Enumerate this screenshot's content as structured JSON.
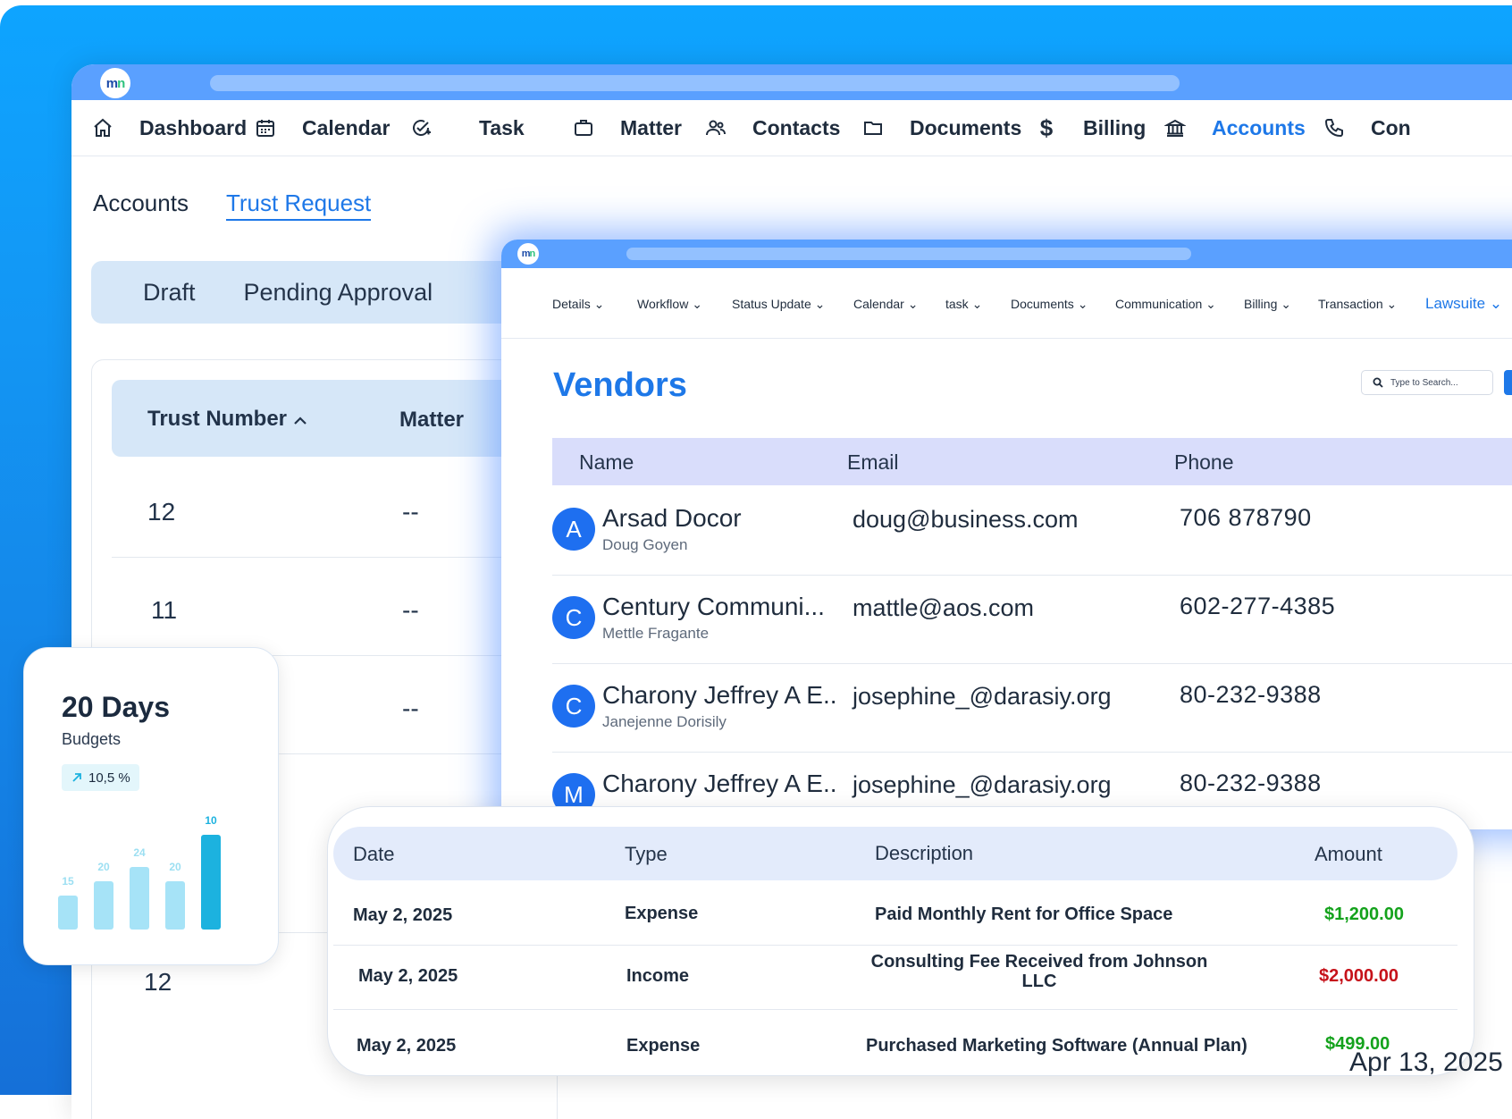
{
  "main_nav": [
    {
      "icon": "home-icon",
      "label": "Dashboard"
    },
    {
      "icon": "calendar-icon",
      "label": "Calendar"
    },
    {
      "icon": "task-check-icon",
      "label": "Task"
    },
    {
      "icon": "briefcase-icon",
      "label": "Matter"
    },
    {
      "icon": "contacts-icon",
      "label": "Contacts"
    },
    {
      "icon": "folder-icon",
      "label": "Documents"
    },
    {
      "icon": "dollar-icon",
      "label": "Billing"
    },
    {
      "icon": "bank-icon",
      "label": "Accounts",
      "active": true
    },
    {
      "icon": "phone-icon",
      "label": "Con"
    }
  ],
  "sub_tabs": {
    "accounts": "Accounts",
    "trust_request": "Trust Request"
  },
  "status_tabs": {
    "draft": "Draft",
    "pending": "Pending Approval"
  },
  "trust_table": {
    "col_trust_number": "Trust Number",
    "col_matter": "Matter",
    "rows": [
      {
        "number": "12",
        "matter": "--"
      },
      {
        "number": "11",
        "matter": "--"
      },
      {
        "number": "",
        "matter": "--"
      },
      {
        "number": "12",
        "matter": ""
      }
    ]
  },
  "vendors_nav": [
    {
      "label": "Details"
    },
    {
      "label": "Workflow"
    },
    {
      "label": "Status Update"
    },
    {
      "label": "Calendar"
    },
    {
      "label": "task"
    },
    {
      "label": "Documents"
    },
    {
      "label": "Communication"
    },
    {
      "label": "Billing"
    },
    {
      "label": "Transaction"
    },
    {
      "label": "Lawsuite",
      "active": true
    }
  ],
  "vendors": {
    "title": "Vendors",
    "search_placeholder": "Type to Search...",
    "col_name": "Name",
    "col_email": "Email",
    "col_phone": "Phone",
    "rows": [
      {
        "initial": "A",
        "name": "Arsad Docor",
        "contact": "Doug Goyen",
        "email": "doug@business.com",
        "phone": "706 878790"
      },
      {
        "initial": "C",
        "name": "Century Communi...",
        "contact": "Mettle Fragante",
        "email": "mattle@aos.com",
        "phone": "602-277-4385"
      },
      {
        "initial": "C",
        "name": "Charony Jeffrey A E..",
        "contact": "Janejenne Dorisily",
        "email": "josephine_@darasiy.org",
        "phone": "80-232-9388"
      },
      {
        "initial": "M",
        "name": "Charony Jeffrey A E..",
        "contact": "",
        "email": "josephine_@darasiy.org",
        "phone": "80-232-9388"
      }
    ]
  },
  "budget_card": {
    "days": "20 Days",
    "label": "Budgets",
    "change": "10,5 %",
    "bars": [
      15,
      20,
      24,
      20,
      10
    ],
    "bar_colors": [
      "#a6e3f7",
      "#a6e3f7",
      "#a6e3f7",
      "#a6e3f7",
      "#1cb2df"
    ]
  },
  "transactions": {
    "col_date": "Date",
    "col_type": "Type",
    "col_description": "Description",
    "col_amount": "Amount",
    "rows": [
      {
        "date": "May 2, 2025",
        "type": "Expense",
        "description": "Paid Monthly Rent for Office Space",
        "amount": "$1,200.00",
        "status_color": "green"
      },
      {
        "date": "May 2, 2025",
        "type": "Income",
        "description": "Consulting Fee Received from Johnson LLC",
        "amount": "$2,000.00",
        "status_color": "red"
      },
      {
        "date": "May 2, 2025",
        "type": "Expense",
        "description": "Purchased Marketing Software (Annual Plan)",
        "amount": "$499.00",
        "status_color": "green"
      }
    ],
    "background_date": "Apr 13, 2025"
  }
}
